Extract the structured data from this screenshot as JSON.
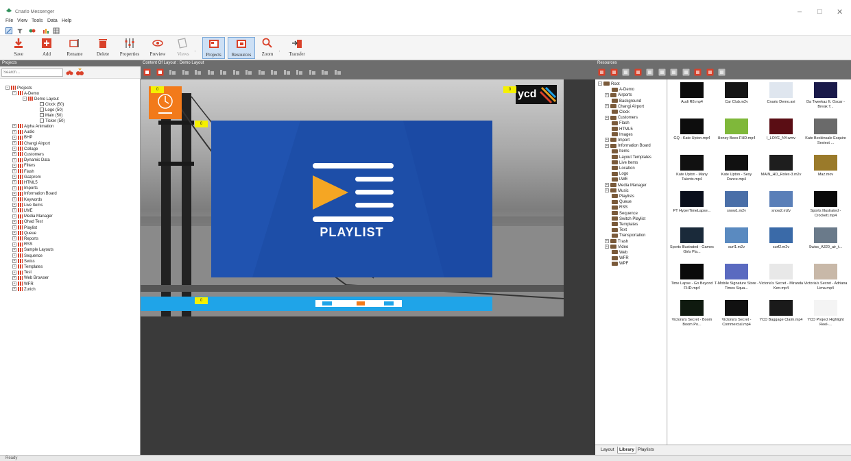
{
  "window": {
    "title": "Cnario Messenger",
    "controls": [
      "–",
      "□",
      "✕"
    ]
  },
  "menu": [
    "File",
    "View",
    "Tools",
    "Data",
    "Help"
  ],
  "ribbon": {
    "buttons": [
      {
        "label": "Save",
        "icon": "save-icon"
      },
      {
        "label": "Add",
        "icon": "add-icon"
      },
      {
        "label": "Rename",
        "icon": "rename-icon"
      },
      {
        "label": "Delete",
        "icon": "delete-icon"
      },
      {
        "label": "Properties",
        "icon": "properties-icon"
      },
      {
        "label": "Preview",
        "icon": "preview-icon"
      },
      {
        "label": "Views",
        "icon": "views-icon"
      },
      {
        "label": "Projects",
        "icon": "projects-icon"
      },
      {
        "label": "Resources",
        "icon": "resources-icon"
      },
      {
        "label": "Zoom",
        "icon": "zoom-icon"
      },
      {
        "label": "Transfer",
        "icon": "transfer-icon"
      }
    ]
  },
  "projects_panel": {
    "header": "Projects",
    "search_placeholder": "Search...",
    "tree": [
      {
        "label": "Projects",
        "level": 0
      },
      {
        "label": "A-Demo",
        "level": 1
      },
      {
        "label": "Demo Layout",
        "level": 2
      },
      {
        "label": "Clock (50)",
        "level": 3
      },
      {
        "label": "Logo (50)",
        "level": 3
      },
      {
        "label": "Main (50)",
        "level": 3
      },
      {
        "label": "Ticker (50)",
        "level": 3
      },
      {
        "label": "Alpha Animation",
        "level": 1
      },
      {
        "label": "Audio",
        "level": 1
      },
      {
        "label": "BHP",
        "level": 1
      },
      {
        "label": "Changi Airport",
        "level": 1
      },
      {
        "label": "Collage",
        "level": 1
      },
      {
        "label": "Customers",
        "level": 1
      },
      {
        "label": "Dynamic Data",
        "level": 1
      },
      {
        "label": "Filters",
        "level": 1
      },
      {
        "label": "Flash",
        "level": 1
      },
      {
        "label": "Gazprom",
        "level": 1
      },
      {
        "label": "HTML5",
        "level": 1
      },
      {
        "label": "Imports",
        "level": 1
      },
      {
        "label": "Information Board",
        "level": 1
      },
      {
        "label": "Keywords",
        "level": 1
      },
      {
        "label": "Live Items",
        "level": 1
      },
      {
        "label": "LWE",
        "level": 1
      },
      {
        "label": "Media Manager",
        "level": 1
      },
      {
        "label": "Ohad Test",
        "level": 1
      },
      {
        "label": "Playlist",
        "level": 1
      },
      {
        "label": "Queue",
        "level": 1
      },
      {
        "label": "Reports",
        "level": 1
      },
      {
        "label": "RSS",
        "level": 1
      },
      {
        "label": "Sample Layouts",
        "level": 1
      },
      {
        "label": "Sequence",
        "level": 1
      },
      {
        "label": "Swiss",
        "level": 1
      },
      {
        "label": "Templates",
        "level": 1
      },
      {
        "label": "Test",
        "level": 1
      },
      {
        "label": "Web Browser",
        "level": 1
      },
      {
        "label": "WFR",
        "level": 1
      },
      {
        "label": "Zurich",
        "level": 1
      }
    ]
  },
  "layout_panel": {
    "header": "Content Of Layout : Demo Layout",
    "badges": [
      "0",
      "0",
      "0",
      "0"
    ],
    "playlist_label": "PLAYLIST",
    "logo_text": "ycd"
  },
  "resources_panel": {
    "header": "Resources",
    "tree": [
      "Root",
      "A-Demo",
      "Airports",
      "Background",
      "Changi Airport",
      "Clock",
      "Customers",
      "Flash",
      "HTML5",
      "Images",
      "Import",
      "Information Board",
      "Items",
      "Layout Templates",
      "Live Items",
      "Location",
      "Logo",
      "LWE",
      "Media Manager",
      "Music",
      "Playlists",
      "Queue",
      "RSS",
      "Sequence",
      "Switch Playlist",
      "Templates",
      "Text",
      "Transportation",
      "Trash",
      "Video",
      "Web",
      "WFR",
      "WPF"
    ],
    "thumbnails": [
      {
        "caption": "Audi R8.mp4",
        "color": "#0c0c0c"
      },
      {
        "caption": "Car Club.m2v",
        "color": "#151515"
      },
      {
        "caption": "Cnario Demo.avi",
        "color": "#dfe6ef"
      },
      {
        "caption": "Da Tweekaz ft. Oscar - Break T...",
        "color": "#1a1a4a"
      },
      {
        "caption": "GQ - Kate Upton.mp4",
        "color": "#0d0d0d"
      },
      {
        "caption": "Honey Bees FHD.mp4",
        "color": "#7fb83a"
      },
      {
        "caption": "I_LOVE_NY.wmv",
        "color": "#5a0d14"
      },
      {
        "caption": "Kate Beckinsale Esquire Sexiest ...",
        "color": "#6a6a6a"
      },
      {
        "caption": "Kate Upton - Many Talents.mp4",
        "color": "#111111"
      },
      {
        "caption": "Kate Upton - Sexy Dance.mp4",
        "color": "#111111"
      },
      {
        "caption": "MAIN_HD_Rolex-3.m2v",
        "color": "#1e1e1e"
      },
      {
        "caption": "Maz.mov",
        "color": "#9a7a2a"
      },
      {
        "caption": "PT HyperTimeLapse...",
        "color": "#0a0f1c"
      },
      {
        "caption": "snow1.m2v",
        "color": "#4a6fa8"
      },
      {
        "caption": "snow2.m2v",
        "color": "#5a7fb8"
      },
      {
        "caption": "Sports Illustrated - Crockett.mp4",
        "color": "#0a0a0a"
      },
      {
        "caption": "Sports Illustrated - Games Girls Pla...",
        "color": "#1a2a3a"
      },
      {
        "caption": "surf1.m2v",
        "color": "#5a8ac0"
      },
      {
        "caption": "surf2.m2v",
        "color": "#3a6aa8"
      },
      {
        "caption": "Swiss_A320_air_t...",
        "color": "#6a7a8a"
      },
      {
        "caption": "Time Lapse - Go Beyond FHD.mp4",
        "color": "#0a0a0a"
      },
      {
        "caption": "T-Mobile Signature Store - Times Squa...",
        "color": "#5a6ac0"
      },
      {
        "caption": "Victoria's Secret - Miranda Kerr.mp4",
        "color": "#e8e8e8"
      },
      {
        "caption": "Victoria's Secret - Adriana Lima.mp4",
        "color": "#c8b8a8"
      },
      {
        "caption": "Victoria's Secret - Boom Boom Po...",
        "color": "#0f1a0f"
      },
      {
        "caption": "Victoria's Secret - Commercial.mp4",
        "color": "#111111"
      },
      {
        "caption": "YCD Baggage Claim.mp4",
        "color": "#1a1a1a"
      },
      {
        "caption": "YCD Project Highlight Reel-...",
        "color": "#f4f4f4"
      }
    ],
    "tabs": [
      "Layout",
      "Library",
      "Playlists"
    ],
    "active_tab": "Library"
  },
  "status": "Ready"
}
